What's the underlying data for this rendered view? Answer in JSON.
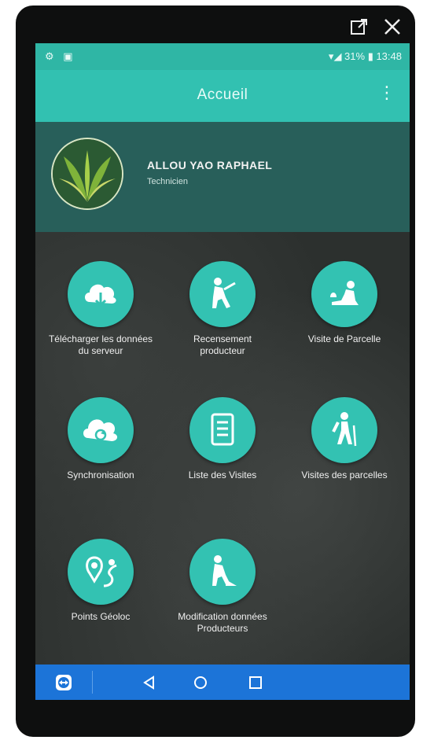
{
  "window": {
    "popout_icon": "popout-icon",
    "close_icon": "close-icon"
  },
  "statusbar": {
    "left": "⚙ ▣",
    "right": "▾◢ 31% ▮ 13:48"
  },
  "appbar": {
    "title": "Accueil",
    "menu_icon": "overflow-menu-icon"
  },
  "profile": {
    "name": "ALLOU YAO RAPHAEL",
    "role": "Technicien"
  },
  "tiles": [
    {
      "label": "Télécharger les données du serveur",
      "icon": "cloud-download-icon"
    },
    {
      "label": "Recensement producteur",
      "icon": "farmer-icon"
    },
    {
      "label": "Visite de Parcelle",
      "icon": "parcel-visit-icon"
    },
    {
      "label": "Synchronisation",
      "icon": "cloud-sync-icon"
    },
    {
      "label": "Liste des Visites",
      "icon": "list-document-icon"
    },
    {
      "label": "Visites des parcelles",
      "icon": "hiker-icon"
    },
    {
      "label": "Points Géoloc",
      "icon": "geolocation-icon"
    },
    {
      "label": "Modification données Producteurs",
      "icon": "edit-farmer-icon"
    }
  ],
  "navbar": {
    "app_icon": "teamviewer-icon",
    "back_icon": "back-icon",
    "home_icon": "home-icon",
    "recents_icon": "recents-icon",
    "color": "#1c74d8"
  },
  "colors": {
    "accent": "#32c1b1",
    "profile_bg": "#285f5a"
  }
}
